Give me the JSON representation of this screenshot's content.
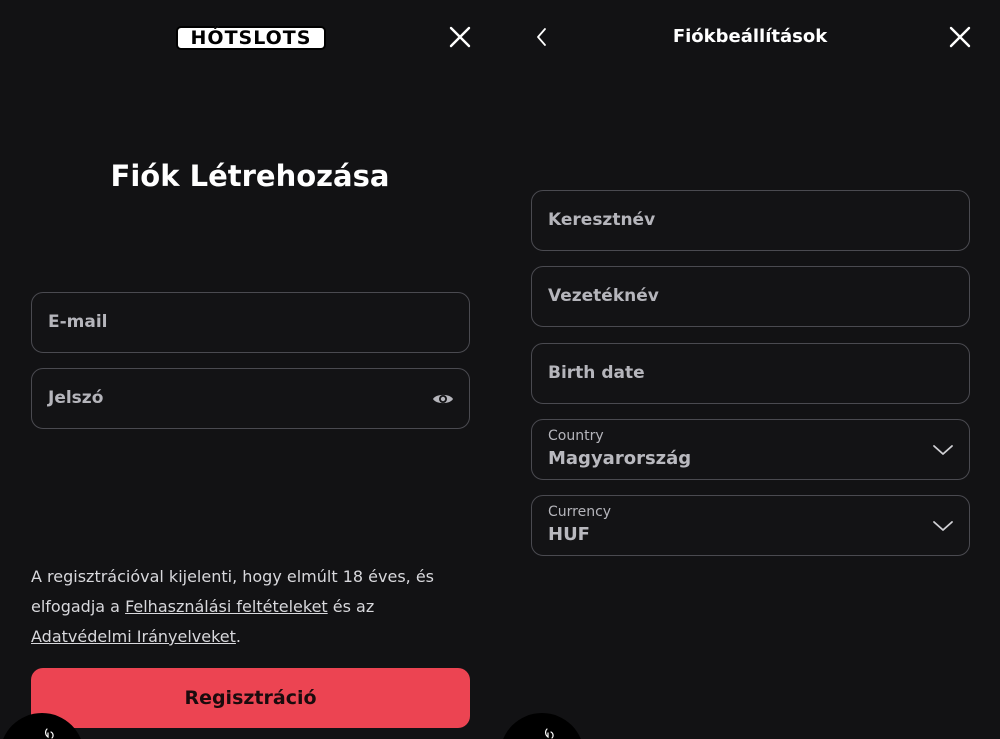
{
  "brand": {
    "logo_text": "HÓTSLOTS"
  },
  "register": {
    "title": "Fiók Létrehozása",
    "email_placeholder": "E-mail",
    "password_placeholder": "Jelszó",
    "legal": {
      "part1": "A regisztrációval kijelenti, hogy elmúlt 18 éves, és elfogadja a ",
      "terms_link": "Felhasználási feltételeket",
      "part2": " és az ",
      "privacy_link": "Adatvédelmi Irányelveket",
      "part3": "."
    },
    "submit_label": "Regisztráció"
  },
  "account": {
    "header_title": "Fiókbeállítások",
    "first_name_placeholder": "Keresztnév",
    "last_name_placeholder": "Vezetéknév",
    "birth_date_placeholder": "Birth date",
    "country": {
      "label": "Country",
      "value": "Magyarország"
    },
    "currency": {
      "label": "Currency",
      "value": "HUF"
    }
  },
  "icons": {
    "close": "close-icon",
    "back": "chevron-left-icon",
    "eye": "eye-icon",
    "chevron": "chevron-down-icon",
    "chat": "chat-icon"
  },
  "colors": {
    "background": "#121214",
    "field_border": "#4a4a50",
    "accent": "#ec4452",
    "muted_text": "#b5b5bb"
  }
}
